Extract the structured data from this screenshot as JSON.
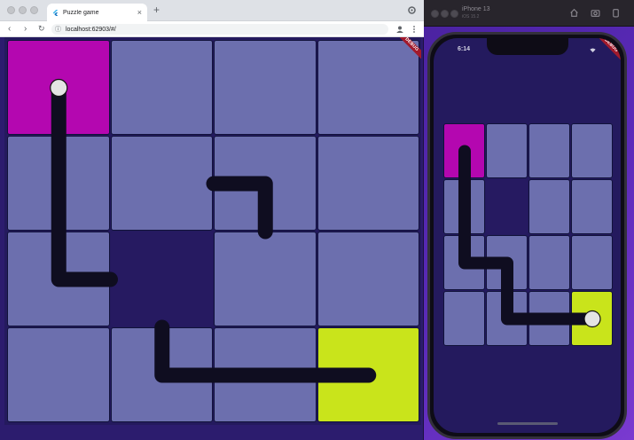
{
  "browser": {
    "tab_title": "Puzzle game",
    "tab_close": "×",
    "new_tab": "+",
    "nav_back": "‹",
    "nav_forward": "›",
    "nav_reload": "↻",
    "url": "localhost:62903/#/",
    "debug_banner": "DEBUG"
  },
  "simulator": {
    "device_name": "iPhone 13",
    "device_os": "iOS 15.2",
    "status_time": "6:14",
    "debug_banner": "DEBUG"
  },
  "colors": {
    "tile": "#6c6fae",
    "empty": "#261a61",
    "start": "#b407b0",
    "end": "#c9e41b",
    "pipe": "#0f0d20",
    "ball": "#e4e4e4",
    "grid_line": "#11123a"
  },
  "game": {
    "rows": 4,
    "cols": 4,
    "browser_board": {
      "cells": [
        [
          "start",
          "tile",
          "tile",
          "tile"
        ],
        [
          "tile",
          "tile",
          "tile",
          "tile"
        ],
        [
          "tile",
          "empty",
          "tile",
          "tile"
        ],
        [
          "tile",
          "tile",
          "tile",
          "end"
        ]
      ],
      "pipe_path": [
        [
          0.5,
          0.5
        ],
        [
          0.5,
          2.5
        ],
        [
          1,
          2.5
        ]
      ],
      "pipe_fragments": [
        [
          [
            2,
            1.5
          ],
          [
            2.5,
            1.5
          ],
          [
            2.5,
            2
          ]
        ],
        [
          [
            1.5,
            3
          ],
          [
            1.5,
            3.5
          ],
          [
            3.5,
            3.5
          ]
        ]
      ],
      "ball": [
        0.5,
        0.5
      ]
    },
    "phone_board": {
      "cells": [
        [
          "start",
          "tile",
          "tile",
          "tile"
        ],
        [
          "tile",
          "empty",
          "tile",
          "tile"
        ],
        [
          "tile",
          "tile",
          "tile",
          "tile"
        ],
        [
          "tile",
          "tile",
          "tile",
          "end"
        ]
      ],
      "pipe_path": [
        [
          0.5,
          0.5
        ],
        [
          0.5,
          2.5
        ],
        [
          1.5,
          2.5
        ],
        [
          1.5,
          3.5
        ],
        [
          3.5,
          3.5
        ]
      ],
      "pipe_fragments": [],
      "ball": [
        3.5,
        3.5
      ]
    }
  }
}
